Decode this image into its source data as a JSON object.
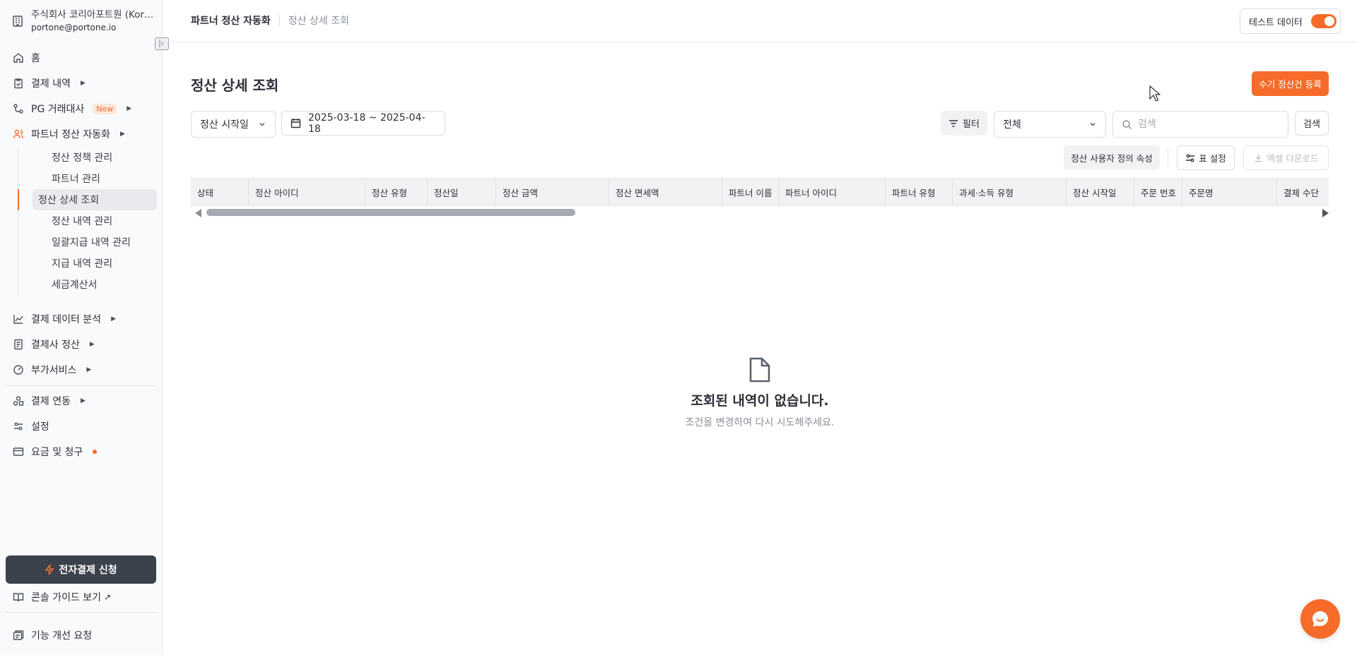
{
  "app": {
    "org_name": "주식회사 코리아포트원 (Kore...",
    "org_email": "portone@portone.io"
  },
  "sidebar": {
    "items": [
      {
        "label": "홈",
        "icon": "home-icon"
      },
      {
        "label": "결제 내역",
        "icon": "clipboard-check-icon"
      },
      {
        "label": "PG 거래대사",
        "icon": "route-icon",
        "badge": "New"
      },
      {
        "label": "파트너 정산 자동화",
        "icon": "users-icon"
      }
    ],
    "sub_items": [
      {
        "label": "정산 정책 관리"
      },
      {
        "label": "파트너 관리"
      },
      {
        "label": "정산 상세 조회"
      },
      {
        "label": "정산 내역 관리"
      },
      {
        "label": "일괄지급 내역 관리"
      },
      {
        "label": "지급 내역 관리"
      },
      {
        "label": "세금계산서"
      }
    ],
    "items2": [
      {
        "label": "결제 데이터 분석",
        "icon": "line-chart-icon"
      },
      {
        "label": "결제사 정산",
        "icon": "receipt-icon"
      },
      {
        "label": "부가서비스",
        "icon": "gauge-icon"
      }
    ],
    "items3": [
      {
        "label": "결제 연동",
        "icon": "shapes-icon"
      },
      {
        "label": "설정",
        "icon": "sliders-icon"
      },
      {
        "label": "요금 및 청구",
        "icon": "credit-card-icon"
      }
    ],
    "pay_button": "전자결제 신청",
    "guide_link": "콘솔 가이드 보기",
    "feedback": "기능 개선 요청"
  },
  "header": {
    "breadcrumb_parent": "파트너 정산 자동화",
    "breadcrumb_current": "정산 상세 조회",
    "test_data_label": "테스트 데이터"
  },
  "main": {
    "title": "정산 상세 조회",
    "manual_button": "수기 정산건 등록",
    "date_type": "정산 시작일",
    "date_range": "2025-03-18 ~ 2025-04-18",
    "filter_label": "필터",
    "filter_select": "전체",
    "search_placeholder": "검색",
    "search_button": "검색",
    "custom_attr_button": "정산 사용자 정의 속성",
    "table_settings_button": "표 설정",
    "excel_button": "엑셀 다운로드",
    "columns": [
      "상태",
      "정산 아이디",
      "정산 유형",
      "정산일",
      "정산 금액",
      "정산 면세액",
      "파트너 이름",
      "파트너 아이디",
      "파트너 유형",
      "과세·소득 유형",
      "정산 시작일",
      "주문 번호",
      "주문명",
      "결제 수단"
    ],
    "empty_title": "조회된 내역이 없습니다.",
    "empty_subtitle": "조건을 변경하여 다시 시도해주세요."
  },
  "colors": {
    "accent": "#f76b2a",
    "dark_button": "#3b424c"
  }
}
